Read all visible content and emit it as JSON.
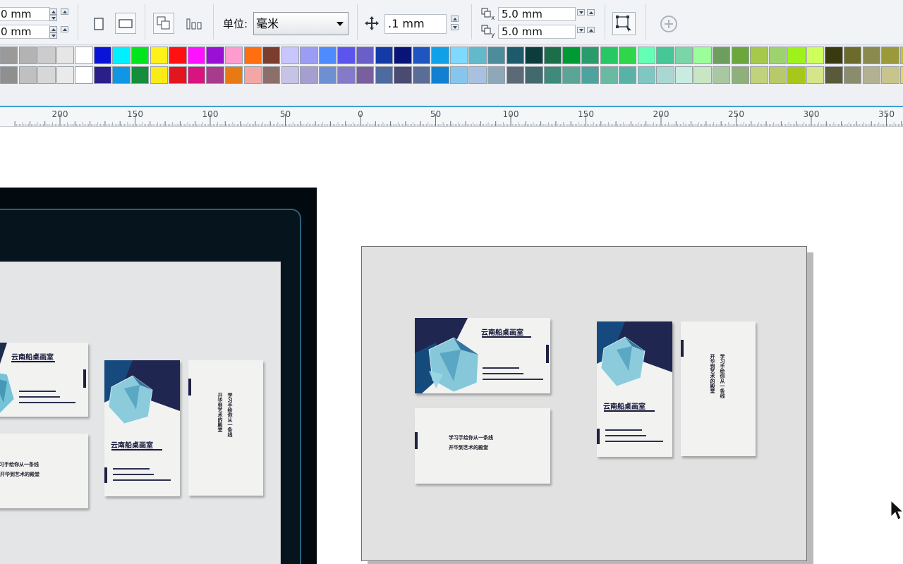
{
  "toolbar": {
    "size_width": "0 mm",
    "size_height": "0 mm",
    "units_label": "单位:",
    "units_value": "毫米",
    "nudge_value": ".1 mm",
    "dup_x": "5.0 mm",
    "dup_y": "5.0 mm"
  },
  "palette": {
    "row1": [
      "#9a9a9a",
      "#b3b3b3",
      "#cccccc",
      "#e6e6e6",
      "#ffffff",
      "#0a14d8",
      "#00f0ff",
      "#00e51b",
      "#fff21a",
      "#ff1111",
      "#ff12ff",
      "#9a11d6",
      "#ff9ccf",
      "#ff6f0f",
      "#7a3d2e",
      "#c9c5ff",
      "#9a9cf5",
      "#4e8bff",
      "#5b55ee",
      "#6a5ec9",
      "#143aa6",
      "#0a1378",
      "#1f55c0",
      "#10a0e8",
      "#7fd9ff",
      "#63b9c9",
      "#4c8c9b",
      "#1d5a6c",
      "#0d3c3d",
      "#1c6e4b",
      "#009a34",
      "#2a9c6c",
      "#27c864",
      "#2fd64a",
      "#62ffb4",
      "#46c796",
      "#7ad6a7",
      "#9aff9a",
      "#6d9e5e",
      "#6aa83c",
      "#a6c94c",
      "#9dd36e",
      "#9ef21a",
      "#cfff5d",
      "#3a3a10",
      "#6b6b2b",
      "#8a8a4e",
      "#9a9a3a",
      "#c6bf3e",
      "#f5eb58"
    ],
    "row2": [
      "#8f8f8f",
      "#c0c0c0",
      "#d7d7d7",
      "#eaeaea",
      "#ffffff",
      "#2a1f8a",
      "#1196e6",
      "#148d3c",
      "#f9ec16",
      "#e3161f",
      "#d8157f",
      "#a83b8c",
      "#e77a14",
      "#f2a6a6",
      "#8c6e6a",
      "#c7c3e6",
      "#a59fd0",
      "#6f8fd3",
      "#8579c9",
      "#7a5f9e",
      "#4d6b9e",
      "#4a4a73",
      "#5a6d96",
      "#137fd1",
      "#86c6ee",
      "#a9c1e0",
      "#8fa8b8",
      "#5c6a78",
      "#426a6e",
      "#3f8a7a",
      "#5aa596",
      "#4ea39e",
      "#69b9a3",
      "#5ab2a7",
      "#7ec7c3",
      "#a9d8d2",
      "#c8ece0",
      "#c8e6c4",
      "#a9c7a0",
      "#8fb07a",
      "#c0d27a",
      "#b8c96a",
      "#a7c81a",
      "#d6e48a",
      "#5a5a3a",
      "#8b8b6e",
      "#b2b292",
      "#c8c48c",
      "#e4d46a",
      "#fff168"
    ]
  },
  "ruler": {
    "labels": [
      "200",
      "150",
      "100",
      "50",
      "0",
      "50",
      "100",
      "150",
      "200",
      "250",
      "300",
      "350"
    ]
  },
  "cards": {
    "company_name": "云南船桌画室",
    "motto_line1": "学习手绘你从一条线",
    "motto_line2": "开华到艺术的殿堂"
  }
}
